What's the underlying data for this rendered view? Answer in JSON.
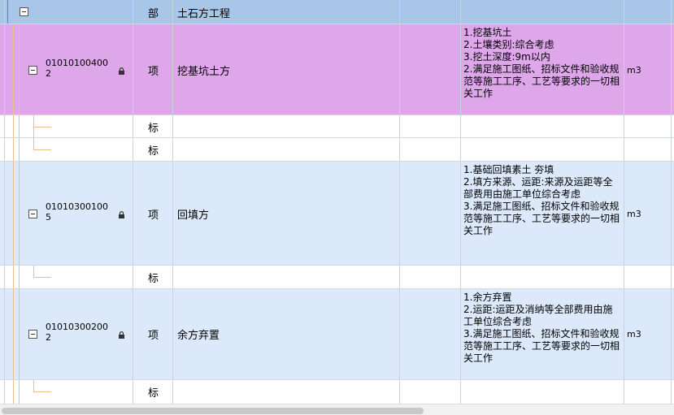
{
  "rows": [
    {
      "kind": "部",
      "name": "土石方工程"
    },
    {
      "code": "010101004002",
      "kind": "项",
      "name": "挖基坑土方",
      "features": "1.挖基坑土\n2.土壤类别:综合考虑\n3.挖土深度:9m以内\n2.满足施工图纸、招标文件和验收规范等施工工序、工艺等要求的一切相关工作",
      "unit": "m3"
    },
    {
      "kind": "标"
    },
    {
      "kind": "标"
    },
    {
      "code": "010103001005",
      "kind": "项",
      "name": "回填方",
      "features": "1.基础回填素土 夯填\n2.填方来源、运距:来源及运距等全部费用由施工单位综合考虑\n3.满足施工图纸、招标文件和验收规范等施工工序、工艺等要求的一切相关工作",
      "unit": "m3"
    },
    {
      "kind": "标"
    },
    {
      "code": "010103002002",
      "kind": "项",
      "name": "余方弃置",
      "features": "1.余方弃置\n2.运距:运距及消纳等全部费用由施工单位综合考虑\n3.满足施工图纸、招标文件和验收规范等施工工序、工艺等要求的一切相关工作",
      "unit": "m3"
    },
    {
      "kind": "标"
    }
  ],
  "colors": {
    "section_row": "#a8c6e8",
    "selected_item_row": "#dda7ea",
    "item_row": "#dce9fa",
    "tree_line": "#e6c089"
  },
  "icons": {
    "collapse": "minus-box-icon",
    "lock": "lock-icon"
  }
}
